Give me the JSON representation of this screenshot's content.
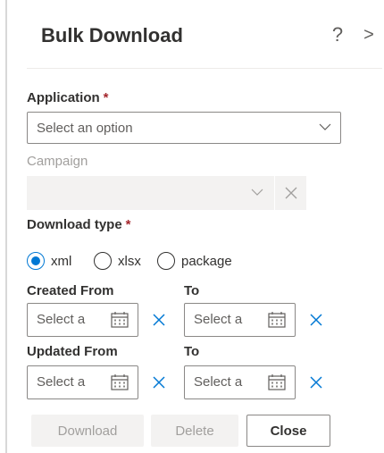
{
  "panel": {
    "title": "Bulk Download",
    "help_glyph": "?",
    "chevron_glyph": ">"
  },
  "application": {
    "label": "Application",
    "required": "*",
    "placeholder": "Select an option"
  },
  "campaign": {
    "label": "Campaign"
  },
  "download_type": {
    "label": "Download type",
    "required": "*",
    "options": [
      "xml",
      "xlsx",
      "package"
    ],
    "selected": "xml"
  },
  "created": {
    "from_label": "Created From",
    "to_label": "To",
    "from_placeholder": "Select a",
    "to_placeholder": "Select a"
  },
  "updated": {
    "from_label": "Updated From",
    "to_label": "To",
    "from_placeholder": "Select a",
    "to_placeholder": "Select a"
  },
  "buttons": {
    "download": "Download",
    "delete": "Delete",
    "close": "Close"
  },
  "colors": {
    "accent": "#0078d4",
    "required": "#a4262c",
    "disabled_bg": "#f3f2f1"
  }
}
